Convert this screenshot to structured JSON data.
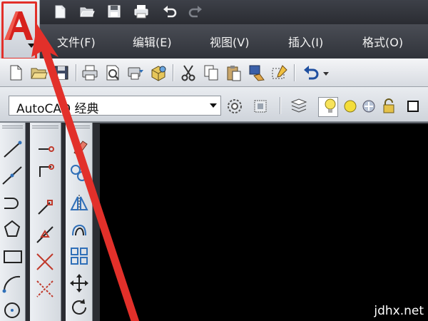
{
  "quick_access": {
    "icons": [
      "new-file-icon",
      "open-folder-icon",
      "save-icon",
      "print-icon",
      "undo-icon",
      "redo-icon"
    ]
  },
  "application_button": {
    "icon": "autocad-logo-icon",
    "dropdown_icon": "chevron-down-icon",
    "highlight_color": "#e2302a"
  },
  "menu": {
    "items": [
      {
        "label": "文件(F)"
      },
      {
        "label": "编辑(E)"
      },
      {
        "label": "视图(V)"
      },
      {
        "label": "插入(I)"
      },
      {
        "label": "格式(O)"
      }
    ]
  },
  "standard_toolbar": {
    "icons": [
      "new-icon",
      "open-icon",
      "save-icon",
      "print-icon",
      "print-preview-icon",
      "publish-icon",
      "3d-dwf-icon",
      "cut-icon",
      "copy-icon",
      "paste-icon",
      "match-properties-icon",
      "block-editor-icon",
      "undo-icon",
      "undo-dropdown-icon"
    ]
  },
  "workspace": {
    "current": "AutoCAD 经典",
    "icons": [
      "workspace-settings-icon",
      "customize-icon",
      "layer-manager-icon",
      "lightbulb-icon",
      "sun-icon",
      "freeze-icon",
      "lock-icon",
      "color-square-icon"
    ]
  },
  "draw_palette": {
    "icons": [
      "line-icon",
      "construction-line-icon",
      "polyline-icon",
      "polygon-icon",
      "rectangle-icon",
      "arc-icon",
      "circle-icon"
    ]
  },
  "snap_palette": {
    "icons": [
      "temp-track-icon",
      "snap-from-icon",
      "endpoint-icon",
      "midpoint-icon",
      "intersection-icon",
      "apparent-intersection-icon"
    ]
  },
  "modify_palette": {
    "icons": [
      "erase-icon",
      "copy-object-icon",
      "mirror-icon",
      "offset-icon",
      "array-icon",
      "move-icon",
      "rotate-icon"
    ]
  },
  "annotation": {
    "arrow_color": "#e2302a"
  },
  "watermark": {
    "text": "jdhx.net"
  }
}
